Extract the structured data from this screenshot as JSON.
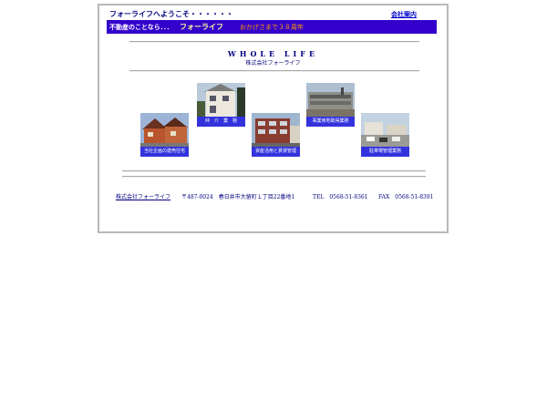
{
  "header": {
    "welcome": "フォーライフへようこそ・・・・・・",
    "company_link": "会社案内"
  },
  "banner": {
    "left_text": "不動産のことなら．．．",
    "brand": "フォーライフ",
    "anniversary": "おかげさまで３８周年"
  },
  "hero": {
    "title": "WHOLE LIFE",
    "subtitle": "株式会社フォーライフ"
  },
  "services": [
    {
      "caption": "当社企画の建売住宅",
      "icon": "house-photo"
    },
    {
      "caption": "仲　介　業　務",
      "icon": "house-photo"
    },
    {
      "caption": "資産活用と賃貸管理",
      "icon": "apartment-photo"
    },
    {
      "caption": "事業用地取得業務",
      "icon": "building-photo"
    },
    {
      "caption": "駐車場管理業務",
      "icon": "parking-photo"
    }
  ],
  "footer": {
    "company": "株式会社フォーライフ",
    "address": "〒487-0024　春日井市大留町１丁目22番地1",
    "tel": "TEL　0568-51-8361",
    "fax": "FAX　0568-51-8391"
  },
  "colors": {
    "banner_bg": "#3300cc",
    "caption_bg": "#3333dd",
    "text_navy": "#000080"
  }
}
